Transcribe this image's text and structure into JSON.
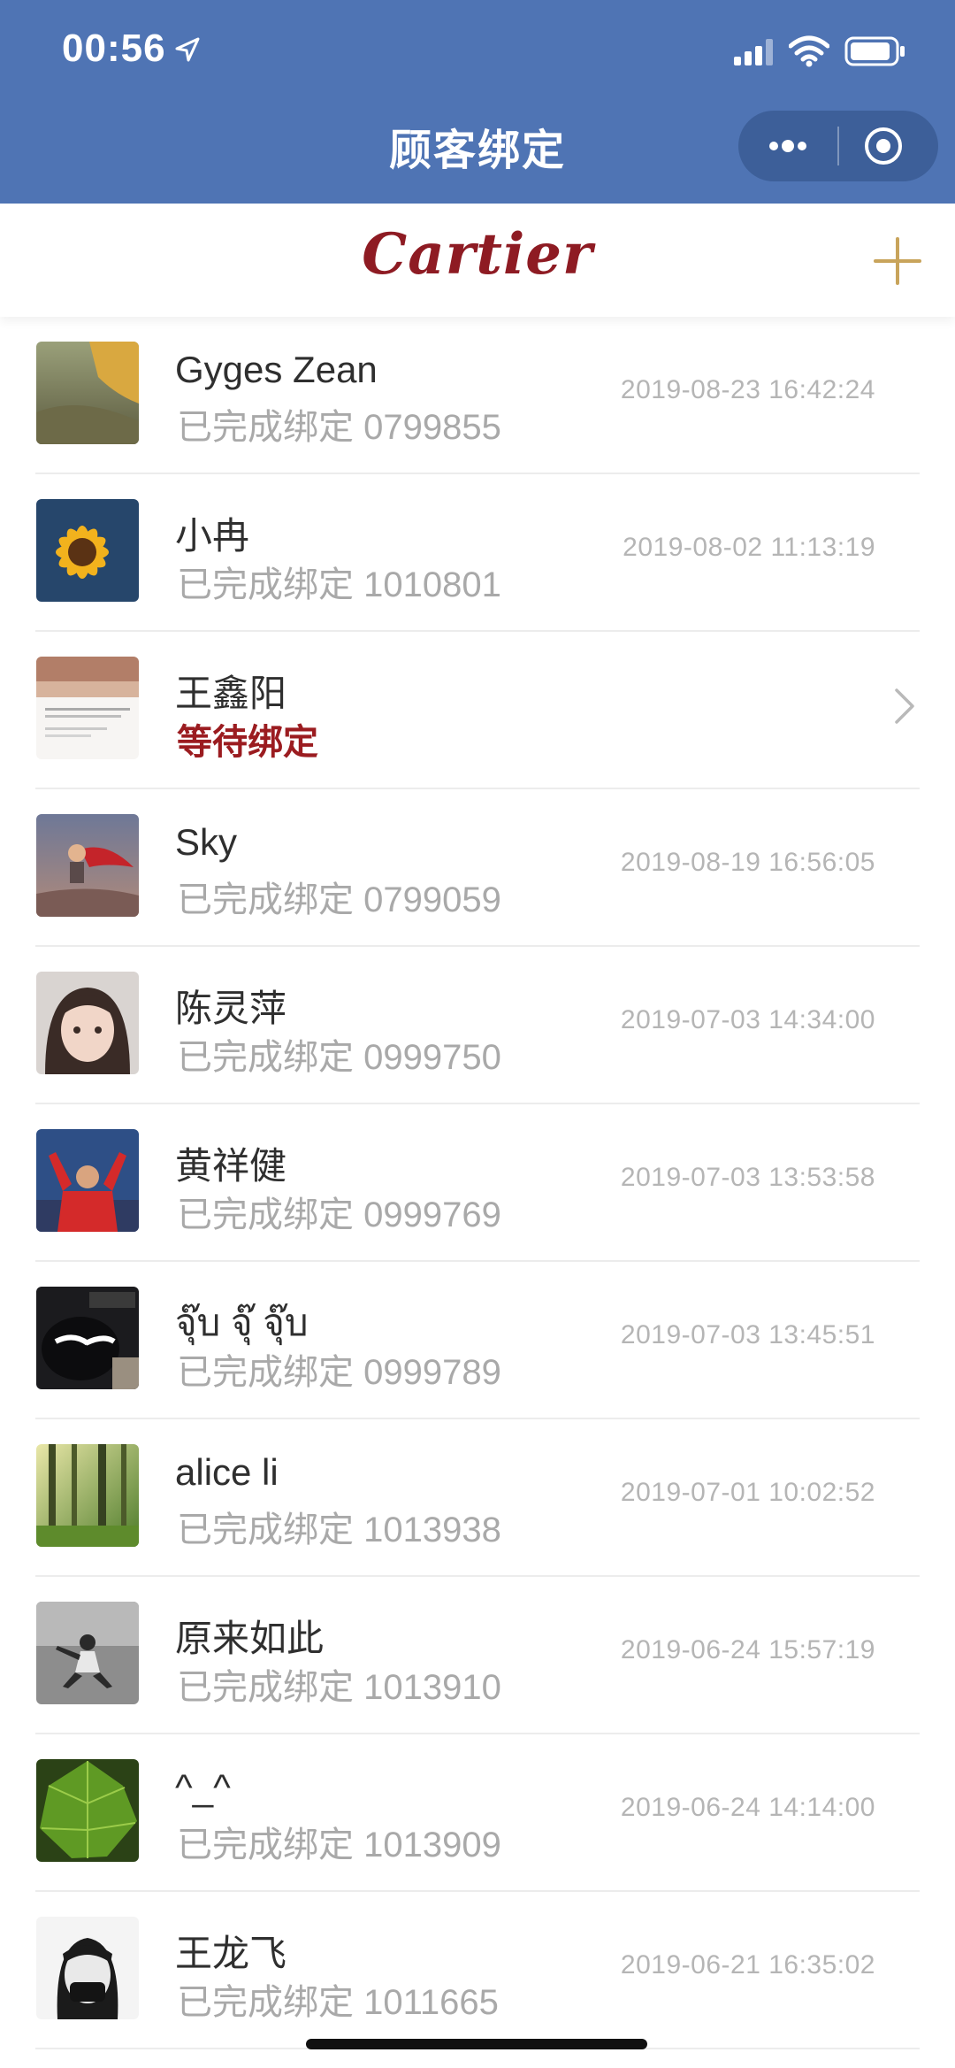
{
  "status_bar": {
    "time": "00:56"
  },
  "nav": {
    "title": "顾客绑定"
  },
  "brand": {
    "logo_text": "Cartier",
    "accent": "#c8a45b",
    "brand_red": "#8e1b23"
  },
  "customers": [
    {
      "name": "Gyges Zean",
      "status": "已完成绑定 0799855",
      "datetime": "2019-08-23 16:42:24",
      "pending": false,
      "avatar": "landscape-hat"
    },
    {
      "name": "小冉",
      "status": "已完成绑定 1010801",
      "datetime": "2019-08-02 11:13:19",
      "pending": false,
      "avatar": "sunflower"
    },
    {
      "name": "王鑫阳",
      "status": "等待绑定",
      "datetime": "",
      "pending": true,
      "avatar": "text-sunset"
    },
    {
      "name": "Sky",
      "status": "已完成绑定 0799059",
      "datetime": "2019-08-19 16:56:05",
      "pending": false,
      "avatar": "child-red-cape"
    },
    {
      "name": "陈灵萍",
      "status": "已完成绑定 0999750",
      "datetime": "2019-07-03 14:34:00",
      "pending": false,
      "avatar": "girl-portrait"
    },
    {
      "name": "黄祥健",
      "status": "已完成绑定 0999769",
      "datetime": "2019-07-03 13:53:58",
      "pending": false,
      "avatar": "footballer"
    },
    {
      "name": "จุ๊บ จุ๊ จุ๊บ",
      "status": "已完成绑定 0999789",
      "datetime": "2019-07-03 13:45:51",
      "pending": false,
      "avatar": "cartoon-dark"
    },
    {
      "name": "alice li",
      "status": "已完成绑定 1013938",
      "datetime": "2019-07-01 10:02:52",
      "pending": false,
      "avatar": "forest"
    },
    {
      "name": "原来如此",
      "status": "已完成绑定 1013910",
      "datetime": "2019-06-24 15:57:19",
      "pending": false,
      "avatar": "bw-figure"
    },
    {
      "name": "^_^",
      "status": "已完成绑定 1013909",
      "datetime": "2019-06-24 14:14:00",
      "pending": false,
      "avatar": "green-leaf"
    },
    {
      "name": "王龙飞",
      "status": "已完成绑定 1011665",
      "datetime": "2019-06-21 16:35:02",
      "pending": false,
      "avatar": "masked-sketch"
    }
  ]
}
